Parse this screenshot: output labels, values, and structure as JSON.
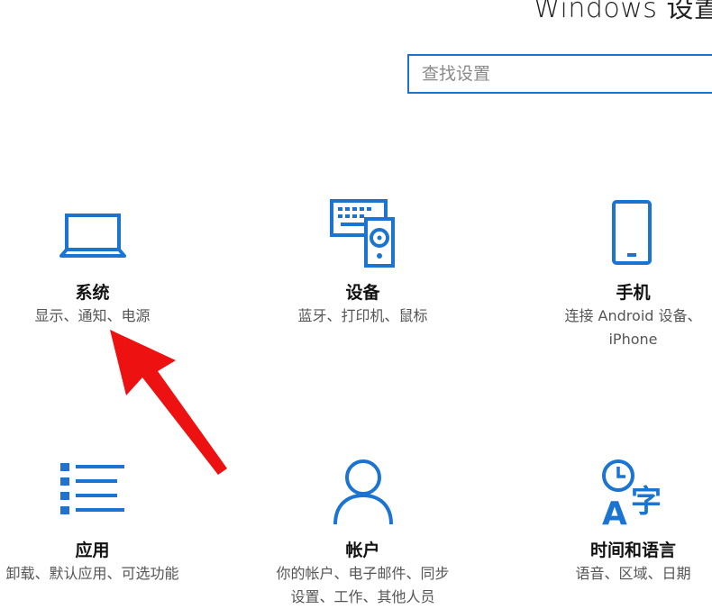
{
  "window": {
    "title": "Windows 设置"
  },
  "search": {
    "placeholder": "查找设置",
    "value": ""
  },
  "tiles": [
    {
      "name": "系统",
      "desc_lines": [
        "显示、通知、电源"
      ],
      "icon": "laptop-icon"
    },
    {
      "name": "设备",
      "desc_lines": [
        "蓝牙、打印机、鼠标"
      ],
      "icon": "devices-icon"
    },
    {
      "name": "手机",
      "desc_lines": [
        "连接 Android 设备、",
        "iPhone"
      ],
      "icon": "phone-icon"
    },
    {
      "name": "应用",
      "desc_lines": [
        "卸载、默认应用、可选功能"
      ],
      "icon": "apps-icon"
    },
    {
      "name": "帐户",
      "desc_lines": [
        "你的帐户、电子邮件、同步",
        "设置、工作、其他人员"
      ],
      "icon": "person-icon"
    },
    {
      "name": "时间和语言",
      "desc_lines": [
        "语音、区域、日期"
      ],
      "icon": "time-language-icon"
    }
  ],
  "annotation": {
    "arrow_color": "#ee1111",
    "icon_color": "#1b74d1"
  }
}
